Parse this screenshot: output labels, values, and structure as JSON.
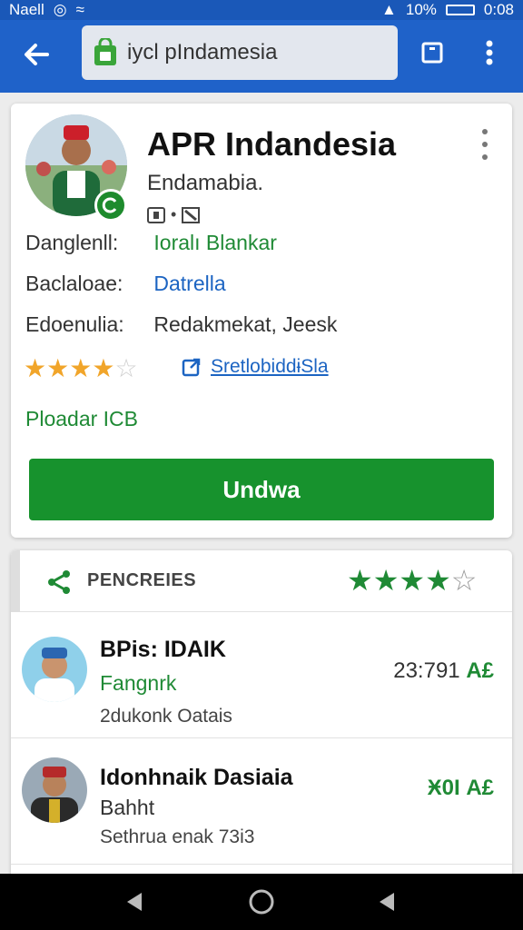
{
  "status_bar": {
    "left_text": "Naell",
    "right_text": "10%",
    "time": "0:08",
    "icons": [
      "signal-icon",
      "wifi-icon",
      "battery-icon"
    ]
  },
  "toolbar": {
    "url": "iycl pIndamesia",
    "icons": [
      "back-arrow-icon",
      "lock-bag-icon",
      "tabs-icon",
      "overflow-menu-icon"
    ]
  },
  "app": {
    "title": "APR Indandesia",
    "developer": "Endamabia.",
    "meta_text": "•",
    "rows": [
      {
        "label": "Danglenll:",
        "value": "Ioralı Blankar"
      },
      {
        "label": "Baclaloae:",
        "value": "Datrella"
      },
      {
        "label": "Edoenulia:",
        "value": "Redakmekat, Jeesk"
      }
    ],
    "rating": 4.5,
    "link_text": "SretlobiddɨSla",
    "footer_label": "Ploadar ICB",
    "install_label": "Undwa",
    "colors": {
      "accent_green": "#17922d",
      "link_blue": "#1c64c2",
      "star_gold": "#f1a52a",
      "toolbar_blue": "#1f62c9"
    }
  },
  "reviews": {
    "title": "PENCREIES",
    "rating": 4,
    "items": [
      {
        "name": "BPis: IDAIK",
        "subtitle": "Fangnrk",
        "detail": "2dukonk Oatais",
        "stat": "23:791",
        "currency": "A£"
      },
      {
        "name": "Idonhnaik Dasiaia",
        "subtitle": "Bahht",
        "detail": "Sethrua enak 73i3",
        "stat": "Ӿ0I",
        "currency": "A£"
      }
    ]
  },
  "nav": {
    "icons": [
      "back-triangle-icon",
      "home-circle-icon",
      "recents-icon"
    ]
  }
}
